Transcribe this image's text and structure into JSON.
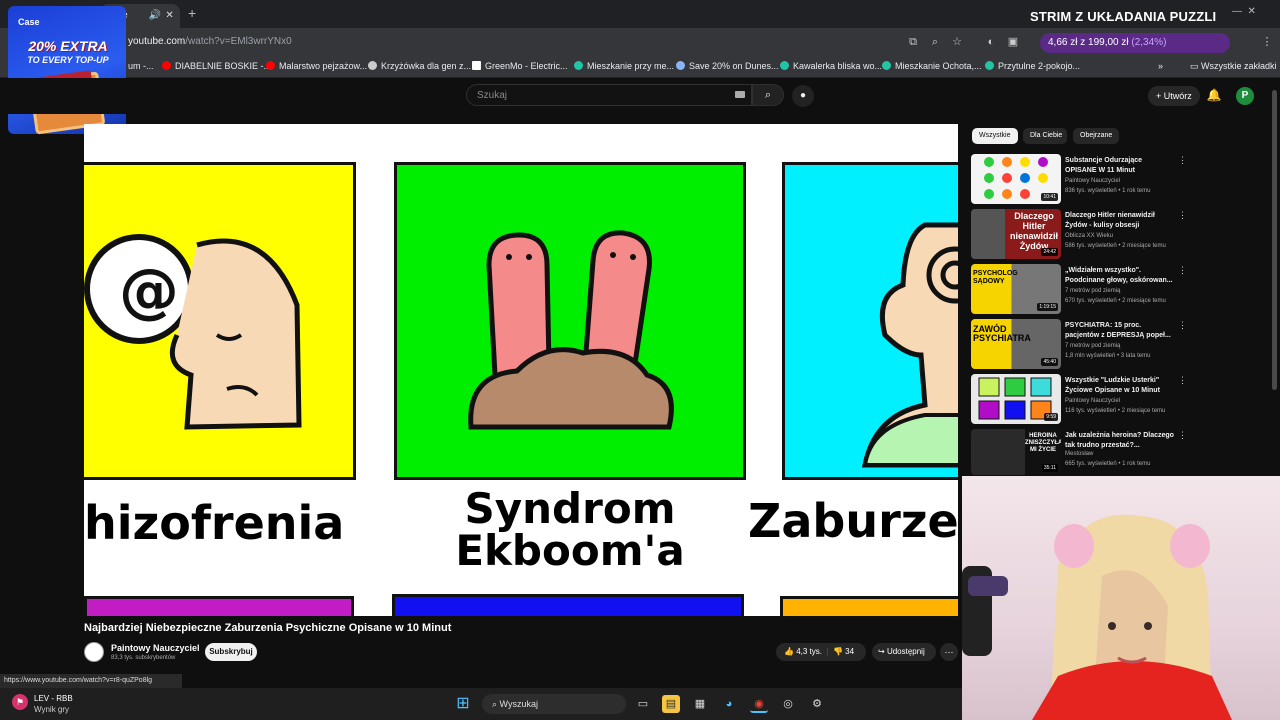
{
  "browser": {
    "tab_title": "ażne",
    "stream_title": "STRIM Z UKŁADANIA PUZZLI",
    "url_host": "youtube.com",
    "url_path": "/watch?v=EMl3wrrYNx0",
    "crypto_widget": {
      "value": "4,66 zł z 199,00 zł",
      "percent": "(2,34%)"
    },
    "bookmarks": [
      {
        "label": "um -...",
        "color": "#888888"
      },
      {
        "label": "DIABELNIE BOSKIE -...",
        "color": "#ff0000"
      },
      {
        "label": "Malarstwo pejzażow...",
        "color": "#ff0000"
      },
      {
        "label": "Krzyżówka dla gen z...",
        "color": "#cccccc"
      },
      {
        "label": "GreenMo - Electric...",
        "color": "#ffffff"
      },
      {
        "label": "Mieszkanie przy me...",
        "color": "#23c4a6"
      },
      {
        "label": "Save 20% on Dunes...",
        "color": "#8ab4f8"
      },
      {
        "label": "Kawalerka bliska wo...",
        "color": "#23c4a6"
      },
      {
        "label": "Mieszkanie Ochota,...",
        "color": "#23c4a6"
      },
      {
        "label": "Przytulne 2-pokojo...",
        "color": "#23c4a6"
      }
    ],
    "all_bookmarks": "Wszystkie zakładki",
    "status_url": "https://www.youtube.com/watch?v=r8-quZPo8lg"
  },
  "ad": {
    "brand": "Case",
    "extra": "20% EXTRA",
    "topup": "TO EVERY TOP-UP"
  },
  "youtube": {
    "search_placeholder": "Szukaj",
    "create_label": "Utwórz",
    "avatar_letter": "P",
    "video": {
      "cards": [
        {
          "label": "hizofrenia",
          "color": "#ffff00"
        },
        {
          "label": "Syndrom\nEkboom'a",
          "color": "#00ee00"
        },
        {
          "label": "Zaburze",
          "color": "#00f0ff"
        }
      ],
      "bottom_colors": [
        "#c21dc4",
        "#1010f0",
        "#ffb300"
      ]
    },
    "title": "Najbardziej Niebezpieczne Zaburzenia Psychiczne Opisane w 10 Minut",
    "channel": "Paintowy Nauczyciel",
    "subscribers": "83,3 tys. subskrybentów",
    "subscribe_label": "Subskrybuj",
    "likes": "4,3 tys.",
    "dislikes": "34",
    "share_label": "Udostępnij",
    "chips": [
      "Wszystkie",
      "Dla Ciebie",
      "Obejrzane"
    ],
    "recommended": [
      {
        "title": "Substancje Odurzające OPISANE W 11 Minut",
        "channel": "Paintowy Nauczyciel",
        "meta": "836 tys. wyświetleń • 1 rok temu",
        "duration": "10:41",
        "thumb": "#f4f4f4"
      },
      {
        "title": "Dlaczego Hitler nienawidził Żydów - kulisy obsesji",
        "channel": "Oblicza XX Wieku",
        "meta": "586 tys. wyświetleń • 2 miesiące temu",
        "duration": "24:42",
        "thumb": "#7a1b1b",
        "thumb_text": "Dlaczego Hitler nienawidził Żydów"
      },
      {
        "title": "„Widziałem wszystko\". Poodcinane głowy, oskórowan...",
        "channel": "7 metrów pod ziemią",
        "meta": "670 tys. wyświetleń • 2 miesiące temu",
        "duration": "1:19:15",
        "thumb": "#f5d400",
        "thumb_text": "PSYCHOLOG SĄDOWY"
      },
      {
        "title": "PSYCHIATRA: 15 proc. pacjentów z DEPRESJĄ popeł...",
        "channel": "7 metrów pod ziemią",
        "meta": "1,8 mln wyświetleń • 3 lata temu",
        "duration": "45:40",
        "thumb": "#f5d400",
        "thumb_text": "ZAWÓD PSYCHIATRA"
      },
      {
        "title": "Wszystkie \"Ludzkie Usterki\" Życiowe Opisane w 10 Minut",
        "channel": "Paintowy Nauczyciel",
        "meta": "116 tys. wyświetleń • 2 miesiące temu",
        "duration": "9:59",
        "thumb": "#e9e9e9"
      },
      {
        "title": "Jak uzależnia heroina? Dlaczego tak trudno przestać?...",
        "channel": "Mestosław",
        "meta": "665 tys. wyświetleń • 1 rok temu",
        "duration": "35:11",
        "thumb": "#3a3a3a",
        "thumb_text": "HEROINA ZNISZCZYŁA MI ŻYCIE"
      }
    ]
  },
  "taskbar": {
    "weather_label": "LEV - RBB",
    "weather_sub": "Wynik gry",
    "search": "Wyszukaj"
  }
}
